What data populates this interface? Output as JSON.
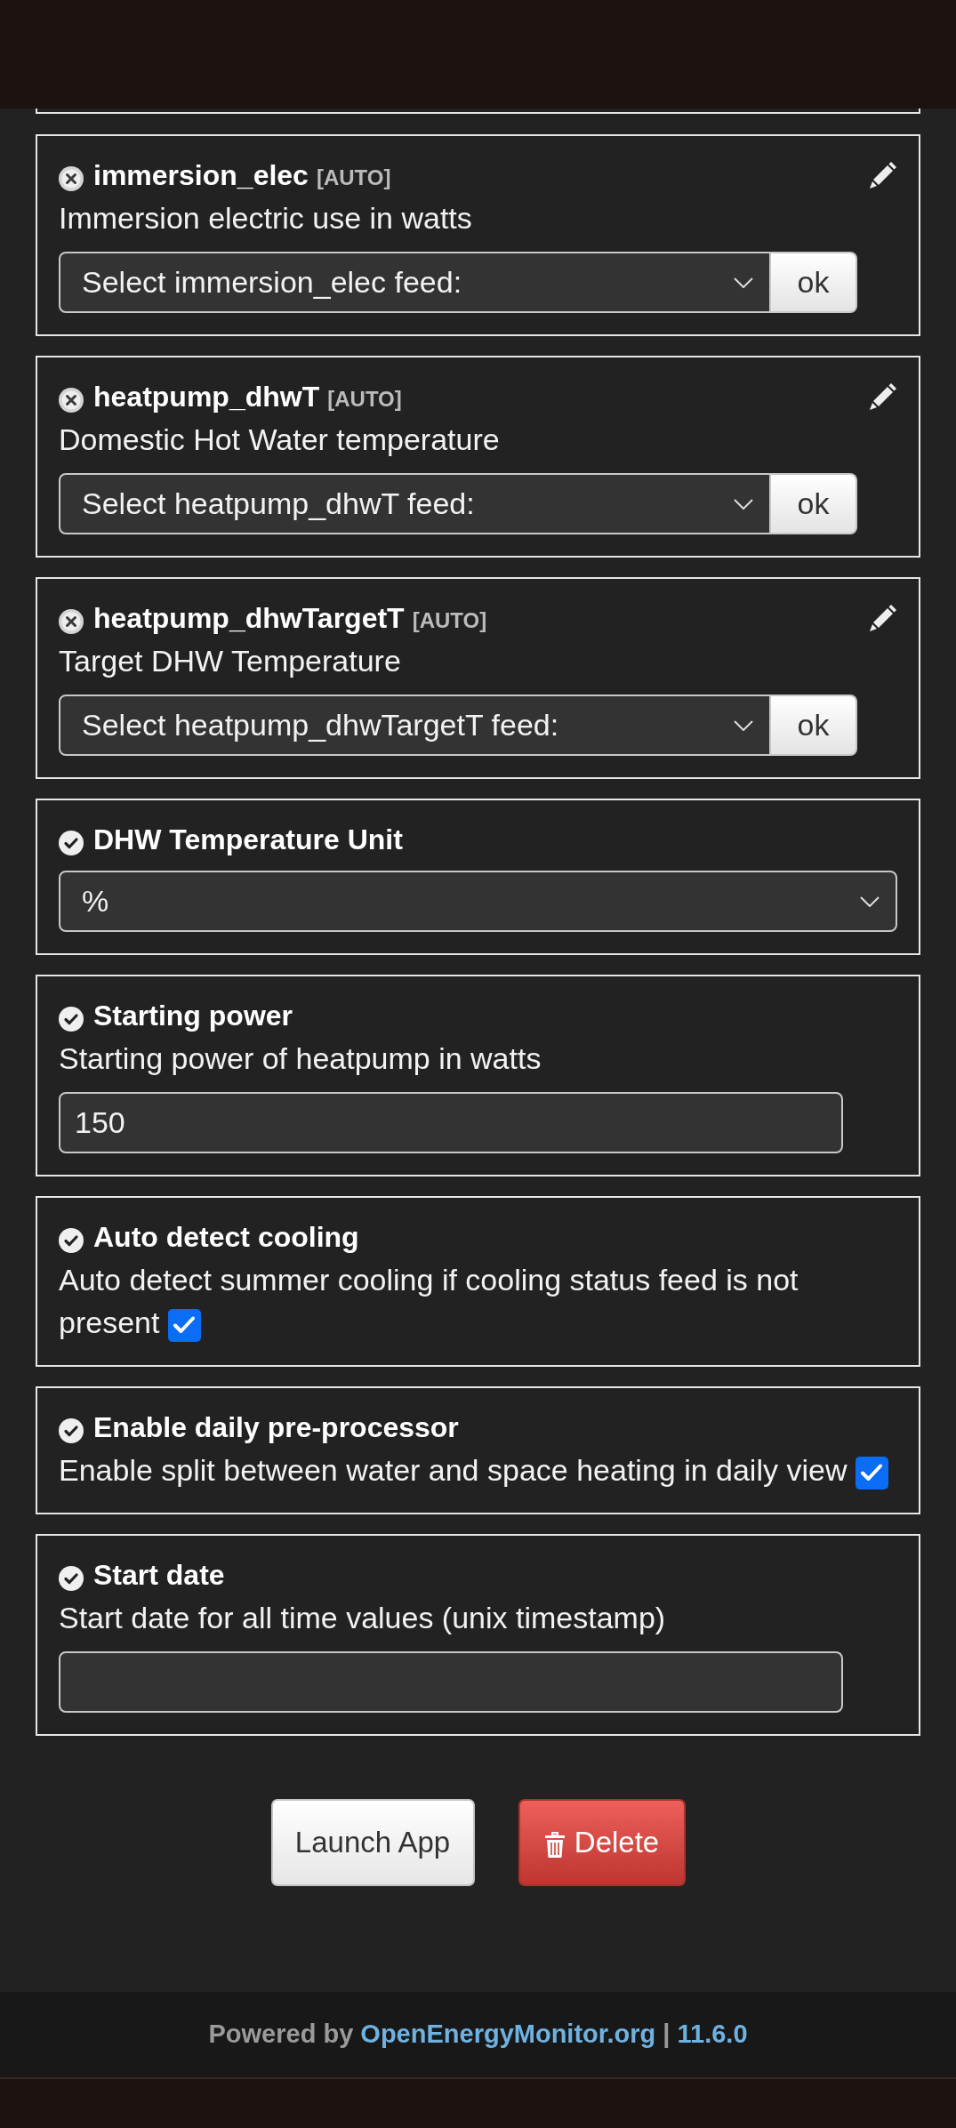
{
  "fields": [
    {
      "kind": "feed",
      "configured": false,
      "name": "immersion_elec",
      "tag": "[AUTO]",
      "description": "Immersion electric use in watts",
      "value": "Select immersion_elec feed:",
      "button": "ok"
    },
    {
      "kind": "feed",
      "configured": false,
      "name": "heatpump_dhwT",
      "tag": "[AUTO]",
      "description": "Domestic Hot Water temperature",
      "value": "Select heatpump_dhwT feed:",
      "button": "ok"
    },
    {
      "kind": "feed",
      "configured": false,
      "name": "heatpump_dhwTargetT",
      "tag": "[AUTO]",
      "description": "Target DHW Temperature",
      "value": "Select heatpump_dhwTargetT feed:",
      "button": "ok"
    },
    {
      "kind": "select",
      "configured": true,
      "name": "DHW Temperature Unit",
      "value": "%"
    },
    {
      "kind": "input",
      "configured": true,
      "name": "Starting power",
      "description": "Starting power of heatpump in watts",
      "value": "150"
    },
    {
      "kind": "checkbox",
      "configured": true,
      "name": "Auto detect cooling",
      "description": "Auto detect summer cooling if cooling status feed is not present",
      "checked": true
    },
    {
      "kind": "checkbox",
      "configured": true,
      "name": "Enable daily pre-processor",
      "description": "Enable split between water and space heating in daily view",
      "checked": true
    },
    {
      "kind": "input",
      "configured": true,
      "name": "Start date",
      "description": "Start date for all time values (unix timestamp)"
    }
  ],
  "actions": [
    {
      "kind": "default",
      "label": "Launch App"
    },
    {
      "kind": "danger",
      "label": "Delete"
    }
  ],
  "footer": {
    "text": "Powered by",
    "link": "OpenEnergyMonitor.org",
    "separator": "|",
    "version": "11.6.0"
  }
}
